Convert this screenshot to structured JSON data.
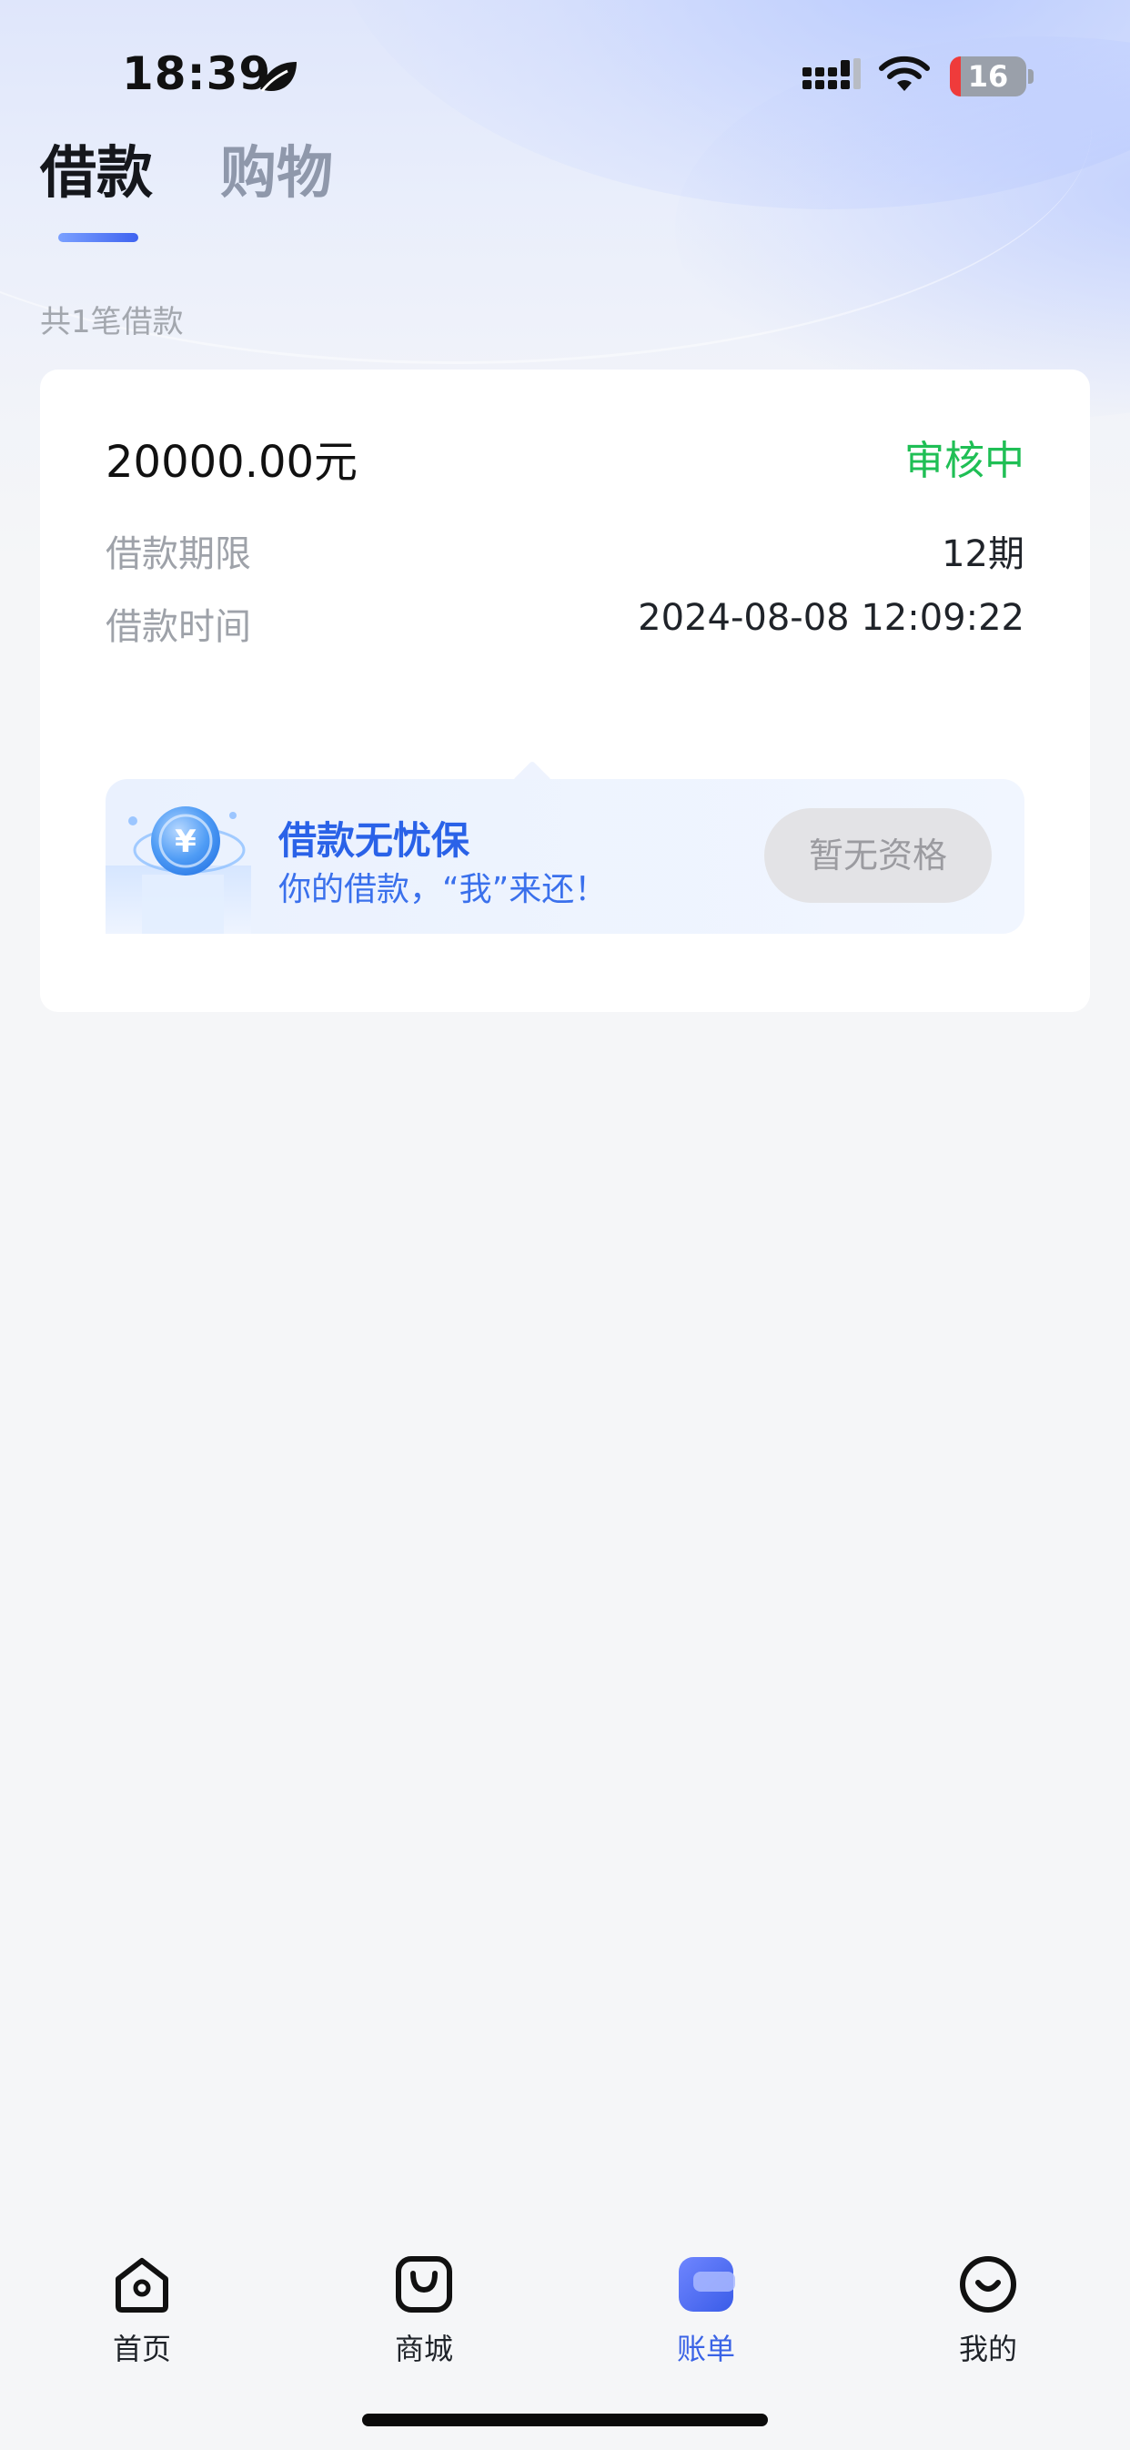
{
  "status_bar": {
    "time": "18:39",
    "battery_level": "16",
    "icons": [
      "leaf-icon",
      "cellular-signal-icon",
      "wifi-icon",
      "battery-icon"
    ],
    "battery_color": "#ef3b3b"
  },
  "tabs": [
    {
      "label": "借款",
      "active": true
    },
    {
      "label": "购物",
      "active": false
    }
  ],
  "summary": {
    "count_text": "共1笔借款"
  },
  "loan_card": {
    "amount": "20000.00元",
    "status": "审核中",
    "status_color": "#1fbf55",
    "term_label": "借款期限",
    "term_value": "12期",
    "time_label": "借款时间",
    "time_value": "2024-08-08 12:09:22"
  },
  "promo": {
    "title": "借款无忧保",
    "subtitle": "你的借款，“我”来还！",
    "button_label": "暂无资格",
    "icon": "yuan-coin-icon",
    "coin_symbol": "¥"
  },
  "bottom_nav": [
    {
      "label": "首页",
      "icon": "home-icon",
      "active": false
    },
    {
      "label": "商城",
      "icon": "shopping-bag-icon",
      "active": false
    },
    {
      "label": "账单",
      "icon": "bill-icon",
      "active": true
    },
    {
      "label": "我的",
      "icon": "smile-icon",
      "active": false
    }
  ],
  "colors": {
    "accent": "#3a63e6",
    "promo_text": "#2a62e8"
  }
}
